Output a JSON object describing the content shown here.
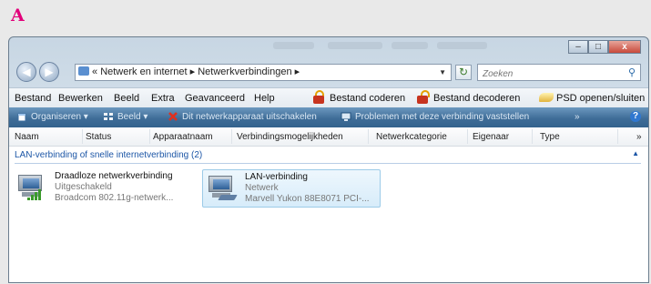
{
  "panel_letter": "A",
  "window": {
    "minimize": "–",
    "maximize": "□",
    "close": "x"
  },
  "address": {
    "back": "◀",
    "forward": "▶",
    "prefix": "«",
    "crumbs": [
      "Netwerk en internet",
      "Netwerkverbindingen"
    ],
    "separator": "▸",
    "refresh_icon": "refresh-icon"
  },
  "search": {
    "placeholder": "Zoeken"
  },
  "menu": {
    "items": [
      "Bestand",
      "Bewerken",
      "Beeld",
      "Extra",
      "Geavanceerd",
      "Help"
    ],
    "encrypt": "Bestand coderen",
    "decrypt": "Bestand decoderen",
    "psd": "PSD openen/sluiten"
  },
  "commands": {
    "organize": "Organiseren",
    "view": "Beeld",
    "disable": "Dit netwerkapparaat uitschakelen",
    "diagnose": "Problemen met deze verbinding vaststellen",
    "more": "»",
    "help": "?"
  },
  "columns": [
    "Naam",
    "Status",
    "Apparaatnaam",
    "Verbindingsmogelijkheden",
    "Netwerkcategorie",
    "Eigenaar",
    "Type",
    "»"
  ],
  "group": {
    "label": "LAN-verbinding of snelle internetverbinding (2)",
    "collapse": "▲"
  },
  "connections": [
    {
      "name": "Draadloze netwerkverbinding",
      "status": "Uitgeschakeld",
      "device": "Broadcom 802.11g-netwerk...",
      "icon": "wireless-network-icon"
    },
    {
      "name": "LAN-verbinding",
      "status": "Netwerk",
      "device": "Marvell Yukon 88E8071 PCI-...",
      "icon": "lan-network-icon"
    }
  ]
}
